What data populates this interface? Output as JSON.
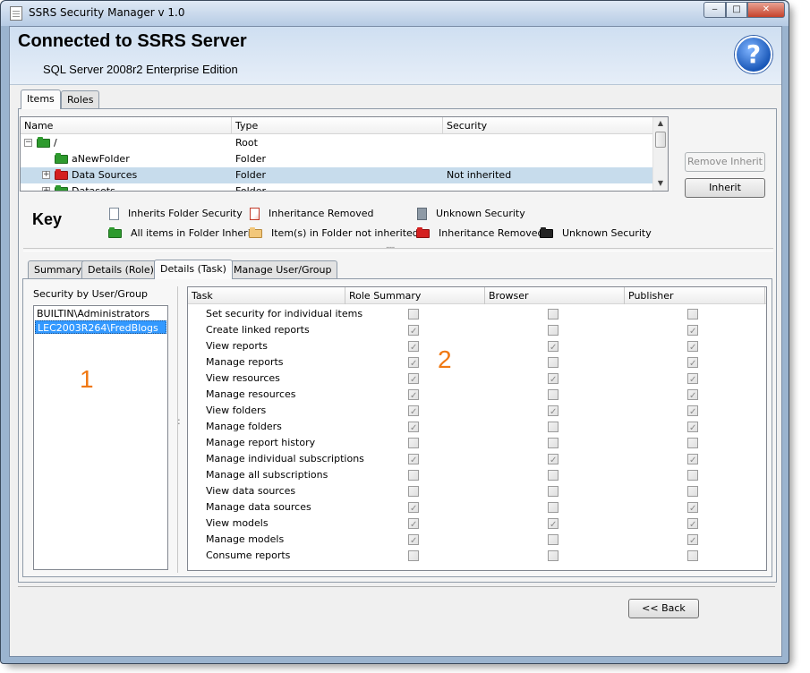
{
  "window": {
    "title": "SSRS Security Manager v 1.0",
    "minimize": "‒",
    "maximize": "□",
    "close": "✕"
  },
  "header": {
    "title": "Connected to SSRS Server",
    "subtitle": "SQL Server 2008r2 Enterprise Edition",
    "help": "?"
  },
  "top_tabs": [
    "Items",
    "Roles"
  ],
  "tree": {
    "columns": [
      "Name",
      "Type",
      "Security"
    ],
    "rows": [
      {
        "expander": "−",
        "name": "/",
        "type": "Root",
        "security": "",
        "folder": "green"
      },
      {
        "expander": "",
        "name": "aNewFolder",
        "type": "Folder",
        "security": "",
        "folder": "green"
      },
      {
        "expander": "+",
        "name": "Data Sources",
        "type": "Folder",
        "security": "Not inherited",
        "folder": "red",
        "selected": true
      },
      {
        "expander": "+",
        "name": "Datasets",
        "type": "Folder",
        "security": "",
        "folder": "green"
      }
    ]
  },
  "buttons": {
    "remove_inherit": "Remove Inherit",
    "inherit": "Inherit",
    "back": "<< Back"
  },
  "key": {
    "title": "Key",
    "items": [
      {
        "label": "Inherits Folder Security",
        "icon": "document-icon"
      },
      {
        "label": "Inheritance Removed",
        "icon": "document-red-icon"
      },
      {
        "label": "Unknown Security",
        "icon": "document-gray-icon"
      },
      {
        "label": "All items in Folder Inherit",
        "icon": "folder-green-icon"
      },
      {
        "label": "Item(s) in Folder not inherited",
        "icon": "folder-tan-icon"
      },
      {
        "label": "Inheritance Removed",
        "icon": "folder-red-icon"
      },
      {
        "label": "Unknown Security",
        "icon": "folder-black-icon"
      }
    ]
  },
  "detail_tabs": [
    "Summary",
    "Details (Role)",
    "Details (Task)",
    "Manage User/Group"
  ],
  "users": {
    "label": "Security by User/Group",
    "items": [
      "BUILTIN\\Administrators",
      "LEC2003R264\\FredBlogs"
    ],
    "selected_index": 1
  },
  "annotations": {
    "one": "1",
    "two": "2"
  },
  "grid": {
    "columns": [
      "Task",
      "Role Summary",
      "Browser",
      "Publisher"
    ],
    "rows": [
      {
        "task": "Set security for individual items",
        "checks": [
          false,
          false,
          false
        ]
      },
      {
        "task": "Create linked reports",
        "checks": [
          true,
          false,
          true
        ]
      },
      {
        "task": "View reports",
        "checks": [
          true,
          true,
          true
        ]
      },
      {
        "task": "Manage reports",
        "checks": [
          true,
          false,
          true
        ]
      },
      {
        "task": "View resources",
        "checks": [
          true,
          true,
          true
        ]
      },
      {
        "task": "Manage resources",
        "checks": [
          true,
          false,
          true
        ]
      },
      {
        "task": "View folders",
        "checks": [
          true,
          true,
          true
        ]
      },
      {
        "task": "Manage folders",
        "checks": [
          true,
          false,
          true
        ]
      },
      {
        "task": "Manage report history",
        "checks": [
          false,
          false,
          false
        ]
      },
      {
        "task": "Manage individual subscriptions",
        "checks": [
          true,
          true,
          true
        ]
      },
      {
        "task": "Manage all subscriptions",
        "checks": [
          false,
          false,
          false
        ]
      },
      {
        "task": "View data sources",
        "checks": [
          false,
          false,
          false
        ]
      },
      {
        "task": "Manage data sources",
        "checks": [
          true,
          false,
          true
        ]
      },
      {
        "task": "View models",
        "checks": [
          true,
          true,
          true
        ]
      },
      {
        "task": "Manage models",
        "checks": [
          true,
          false,
          true
        ]
      },
      {
        "task": "Consume reports",
        "checks": [
          false,
          false,
          false
        ]
      }
    ]
  }
}
